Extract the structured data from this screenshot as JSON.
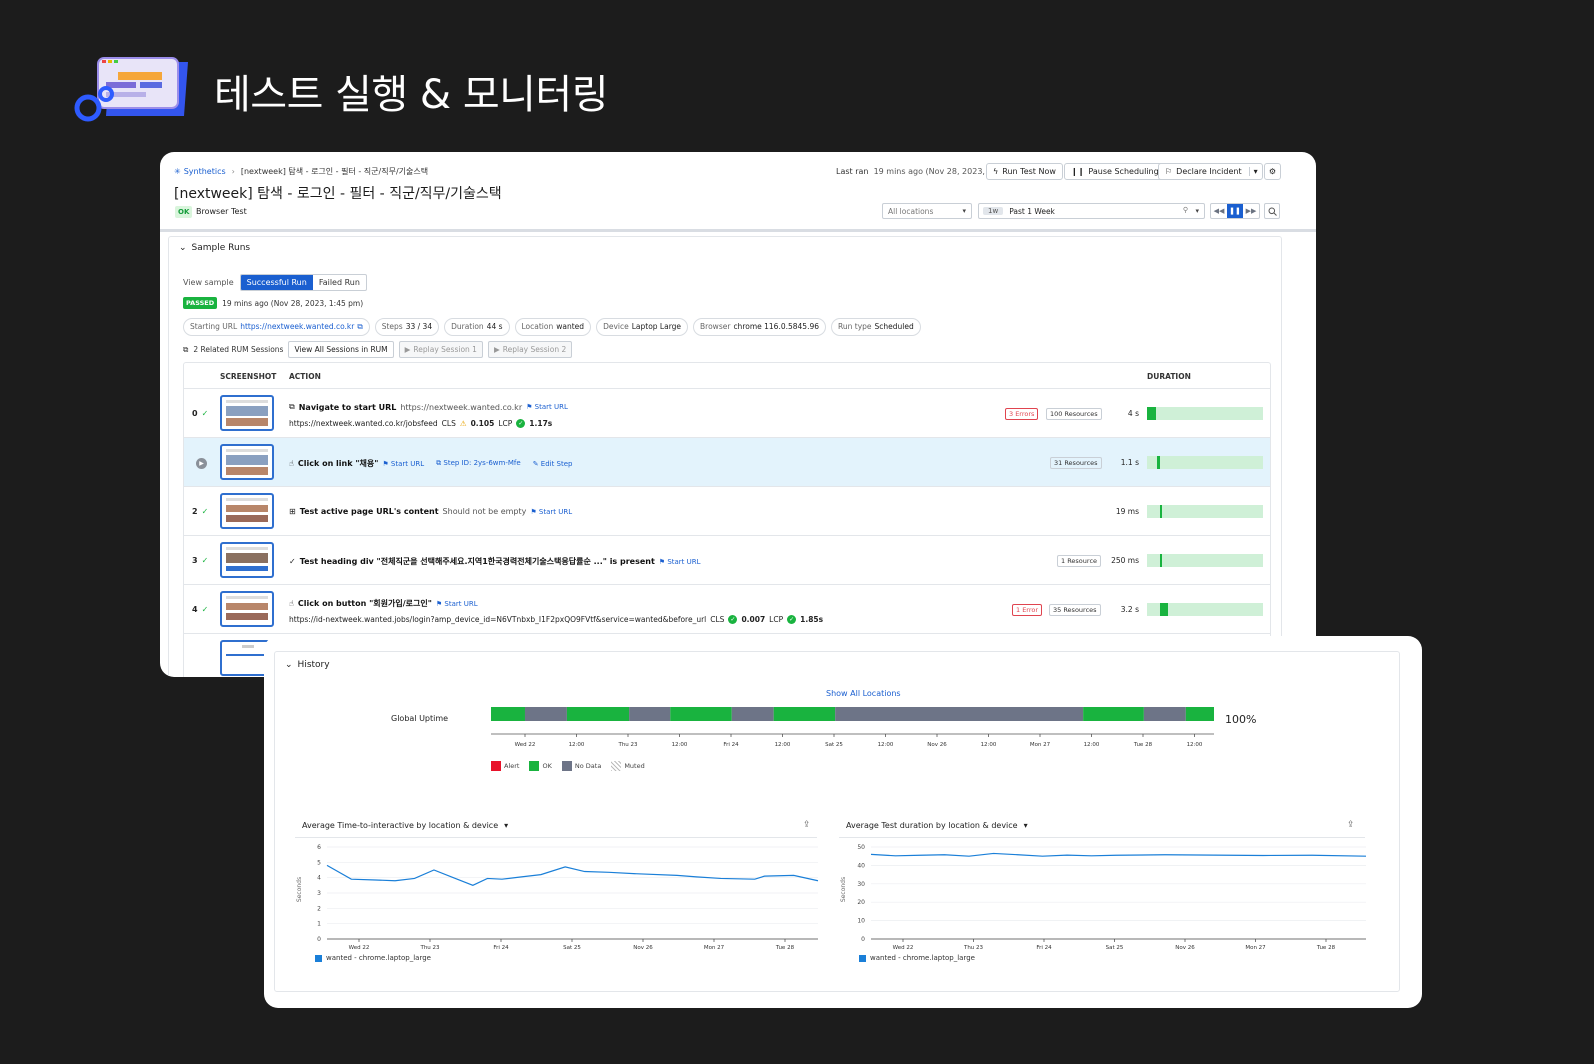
{
  "hero": {
    "title": "테스트 실행 & 모니터링"
  },
  "header": {
    "breadcrumb_root": "Synthetics",
    "breadcrumb_leaf": "[nextweek] 탐색 - 로그인 - 필터 - 직군/직무/기술스택",
    "title": "[nextweek] 탐색 - 로그인 - 필터 - 직군/직무/기술스택",
    "status_badge": "OK",
    "test_type": "Browser Test",
    "last_ran_label": "Last ran",
    "last_ran_value": "19 mins ago (Nov 28, 2023, 1:45 pm)",
    "run_test_now": "Run Test Now",
    "pause_scheduling": "Pause Scheduling",
    "declare_incident": "Declare Incident",
    "locations": "All locations",
    "time_tag": "1w",
    "time_range": "Past 1 Week"
  },
  "sample_runs": {
    "section_title": "Sample Runs",
    "view_sample_label": "View sample",
    "successful_run": "Successful Run",
    "failed_run": "Failed Run",
    "passed_badge": "PASSED",
    "passed_time": "19 mins ago (Nov 28, 2023, 1:45 pm)",
    "chips": [
      {
        "label": "Starting URL",
        "value": "https://nextweek.wanted.co.kr"
      },
      {
        "label": "Steps",
        "value": "33 / 34"
      },
      {
        "label": "Duration",
        "value": "44 s"
      },
      {
        "label": "Location",
        "value": "wanted"
      },
      {
        "label": "Device",
        "value": "Laptop Large"
      },
      {
        "label": "Browser",
        "value": "chrome 116.0.5845.96"
      },
      {
        "label": "Run type",
        "value": "Scheduled"
      }
    ],
    "rum_label": "2 Related RUM Sessions",
    "view_all_sessions": "View All Sessions in RUM",
    "replay_1": "Replay Session 1",
    "replay_2": "Replay Session 2"
  },
  "table": {
    "col_screenshot": "SCREENSHOT",
    "col_action": "ACTION",
    "col_duration": "DURATION",
    "rows": [
      {
        "index": "0",
        "title": "Navigate to start URL",
        "detail": "https://nextweek.wanted.co.kr",
        "link": "Start URL",
        "line2": "https://nextweek.wanted.co.kr/jobsfeed",
        "cls_label": "CLS",
        "cls": "0.105",
        "lcp_label": "LCP",
        "lcp": "1.17s",
        "errors": "3 Errors",
        "resources": "100 Resources",
        "duration": "4 s",
        "duration_fraction": 0.08
      },
      {
        "index": "",
        "title": "Click on link \"채용\"",
        "link": "Start URL",
        "step_id": "Step ID: 2ys-6wm-Mfe",
        "edit": "Edit Step",
        "resources": "31 Resources",
        "duration": "1.1 s",
        "duration_fraction": 0.02
      },
      {
        "index": "2",
        "title": "Test active page URL's content",
        "detail": "Should not be empty",
        "link": "Start URL",
        "duration": "19 ms",
        "duration_fraction": 0.01
      },
      {
        "index": "3",
        "title": "Test heading div \"전체직군을 선택해주세요.지역1한국경력전체기술스택응답률순 ...\" is present",
        "link": "Start URL",
        "resources": "1 Resource",
        "duration": "250 ms",
        "duration_fraction": 0.01
      },
      {
        "index": "4",
        "title": "Click on button \"회원가입/로그인\"",
        "link": "Start URL",
        "line2": "https://id-nextweek.wanted.jobs/login?amp_device_id=N6VTnbxb_I1F2pxQO9FVtf&service=wanted&before_url",
        "cls_label": "CLS",
        "cls": "0.007",
        "lcp_label": "LCP",
        "lcp": "1.85s",
        "errors": "1 Error",
        "resources": "35 Resources",
        "duration": "3.2 s",
        "duration_fraction": 0.07
      }
    ]
  },
  "history": {
    "section_title": "History",
    "show_all_locations": "Show All Locations",
    "global_uptime_label": "Global Uptime",
    "uptime_pct": "100%",
    "uptime_segments": [
      {
        "state": "ok",
        "fraction": 0.047
      },
      {
        "state": "nodata",
        "fraction": 0.058
      },
      {
        "state": "ok",
        "fraction": 0.086
      },
      {
        "state": "nodata",
        "fraction": 0.057
      },
      {
        "state": "ok",
        "fraction": 0.085
      },
      {
        "state": "nodata",
        "fraction": 0.058
      },
      {
        "state": "ok",
        "fraction": 0.085
      },
      {
        "state": "nodata",
        "fraction": 0.343
      },
      {
        "state": "ok",
        "fraction": 0.084
      },
      {
        "state": "nodata",
        "fraction": 0.058
      },
      {
        "state": "ok",
        "fraction": 0.039
      }
    ],
    "uptime_ticks": [
      "Wed 22",
      "12:00",
      "Thu 23",
      "12:00",
      "Fri 24",
      "12:00",
      "Sat 25",
      "12:00",
      "Nov 26",
      "12:00",
      "Mon 27",
      "12:00",
      "Tue 28",
      "12:00"
    ],
    "legend": [
      {
        "label": "Alert",
        "color": "#e8122a"
      },
      {
        "label": "OK",
        "color": "#19b33f"
      },
      {
        "label": "No Data",
        "color": "#6d7487"
      },
      {
        "label": "Muted",
        "color": "#bbbbbb"
      }
    ],
    "colors": {
      "ok": "#19b33f",
      "nodata": "#6d7487",
      "line": "#1a7fd8"
    }
  },
  "chart_data": [
    {
      "type": "line",
      "title": "Average Time-to-interactive by location & device",
      "ylabel": "Seconds",
      "ylim": [
        0,
        6
      ],
      "yticks": [
        "0",
        "1",
        "2",
        "3",
        "4",
        "5",
        "6"
      ],
      "xticks": [
        "Wed 22",
        "Thu 23",
        "Fri 24",
        "Sat 25",
        "Nov 26",
        "Mon 27",
        "Tue 28"
      ],
      "series": [
        {
          "name": "wanted - chrome.laptop_large",
          "x": [
            0,
            0.5,
            1,
            1.4,
            1.8,
            2.2,
            2.6,
            3.0,
            3.3,
            3.6,
            4.0,
            4.4,
            4.9,
            5.3,
            5.8,
            6.4,
            7.2,
            7.6,
            8.1,
            8.8,
            9.0,
            9.6,
            10.1
          ],
          "values": [
            4.8,
            3.9,
            3.85,
            3.8,
            3.95,
            4.5,
            4.0,
            3.5,
            3.95,
            3.9,
            4.05,
            4.2,
            4.7,
            4.4,
            4.35,
            4.25,
            4.15,
            4.05,
            3.95,
            3.9,
            4.1,
            4.15,
            3.8
          ]
        }
      ]
    },
    {
      "type": "line",
      "title": "Average Test duration by location & device",
      "ylabel": "Seconds",
      "ylim": [
        0,
        50
      ],
      "yticks": [
        "0",
        "10",
        "20",
        "30",
        "40",
        "50"
      ],
      "xticks": [
        "Wed 22",
        "Thu 23",
        "Fri 24",
        "Sat 25",
        "Nov 26",
        "Mon 27",
        "Tue 28"
      ],
      "series": [
        {
          "name": "wanted - chrome.laptop_large",
          "x": [
            0,
            0.5,
            1,
            1.5,
            2,
            2.5,
            3,
            3.5,
            4,
            4.5,
            5,
            6,
            7,
            8,
            9,
            10.1
          ],
          "values": [
            46,
            45.2,
            45.5,
            45.8,
            45,
            46.5,
            45.8,
            45,
            45.6,
            45.2,
            45.5,
            45.8,
            45.6,
            45.4,
            45.5,
            45
          ]
        }
      ]
    }
  ]
}
